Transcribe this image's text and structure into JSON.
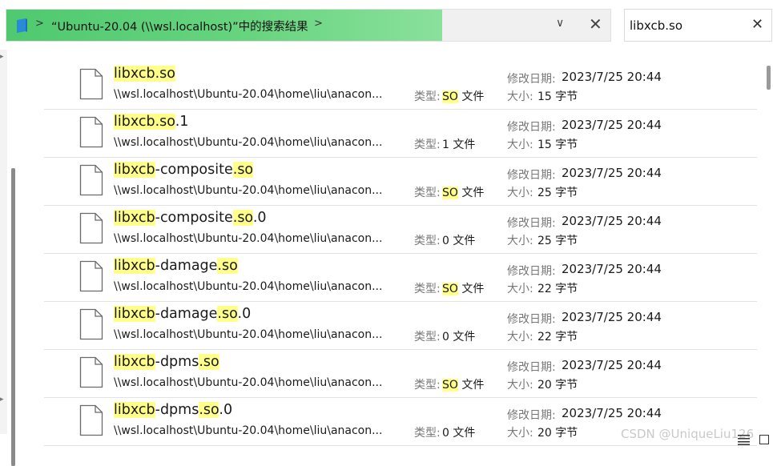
{
  "address_bar": {
    "breadcrumb": "“Ubuntu-20.04 (\\\\wsl.localhost)”中的搜索结果",
    "sep1": ">",
    "sep2": ">",
    "dropdown": "∨",
    "close": "✕"
  },
  "search": {
    "query": "libxcb.so",
    "clear": "✕"
  },
  "labels": {
    "type": "类型:",
    "date": "修改日期:",
    "size": "大小:"
  },
  "files": [
    {
      "name_parts": [
        {
          "t": "libxcb.so",
          "h": true
        }
      ],
      "path": "\\\\wsl.localhost\\Ubuntu-20.04\\home\\liu\\anacon...",
      "type_parts": [
        {
          "t": "SO",
          "h": true
        },
        {
          "t": " 文件",
          "h": false
        }
      ],
      "date": "2023/7/25 20:44",
      "size": "15 字节"
    },
    {
      "name_parts": [
        {
          "t": "libxcb.so",
          "h": true
        },
        {
          "t": ".1",
          "h": false
        }
      ],
      "path": "\\\\wsl.localhost\\Ubuntu-20.04\\home\\liu\\anacon...",
      "type_parts": [
        {
          "t": "1 文件",
          "h": false
        }
      ],
      "date": "2023/7/25 20:44",
      "size": "15 字节"
    },
    {
      "name_parts": [
        {
          "t": "libxcb",
          "h": true
        },
        {
          "t": "-composite",
          "h": false
        },
        {
          "t": ".so",
          "h": true
        }
      ],
      "path": "\\\\wsl.localhost\\Ubuntu-20.04\\home\\liu\\anacon...",
      "type_parts": [
        {
          "t": "SO",
          "h": true
        },
        {
          "t": " 文件",
          "h": false
        }
      ],
      "date": "2023/7/25 20:44",
      "size": "25 字节"
    },
    {
      "name_parts": [
        {
          "t": "libxcb",
          "h": true
        },
        {
          "t": "-composite",
          "h": false
        },
        {
          "t": ".so",
          "h": true
        },
        {
          "t": ".0",
          "h": false
        }
      ],
      "path": "\\\\wsl.localhost\\Ubuntu-20.04\\home\\liu\\anacon...",
      "type_parts": [
        {
          "t": "0 文件",
          "h": false
        }
      ],
      "date": "2023/7/25 20:44",
      "size": "25 字节"
    },
    {
      "name_parts": [
        {
          "t": "libxcb",
          "h": true
        },
        {
          "t": "-damage",
          "h": false
        },
        {
          "t": ".so",
          "h": true
        }
      ],
      "path": "\\\\wsl.localhost\\Ubuntu-20.04\\home\\liu\\anacon...",
      "type_parts": [
        {
          "t": "SO",
          "h": true
        },
        {
          "t": " 文件",
          "h": false
        }
      ],
      "date": "2023/7/25 20:44",
      "size": "22 字节"
    },
    {
      "name_parts": [
        {
          "t": "libxcb",
          "h": true
        },
        {
          "t": "-damage",
          "h": false
        },
        {
          "t": ".so",
          "h": true
        },
        {
          "t": ".0",
          "h": false
        }
      ],
      "path": "\\\\wsl.localhost\\Ubuntu-20.04\\home\\liu\\anacon...",
      "type_parts": [
        {
          "t": "0 文件",
          "h": false
        }
      ],
      "date": "2023/7/25 20:44",
      "size": "22 字节"
    },
    {
      "name_parts": [
        {
          "t": "libxcb",
          "h": true
        },
        {
          "t": "-dpms",
          "h": false
        },
        {
          "t": ".so",
          "h": true
        }
      ],
      "path": "\\\\wsl.localhost\\Ubuntu-20.04\\home\\liu\\anacon...",
      "type_parts": [
        {
          "t": "SO",
          "h": true
        },
        {
          "t": " 文件",
          "h": false
        }
      ],
      "date": "2023/7/25 20:44",
      "size": "20 字节"
    },
    {
      "name_parts": [
        {
          "t": "libxcb",
          "h": true
        },
        {
          "t": "-dpms",
          "h": false
        },
        {
          "t": ".so",
          "h": true
        },
        {
          "t": ".0",
          "h": false
        }
      ],
      "path": "\\\\wsl.localhost\\Ubuntu-20.04\\home\\liu\\anacon...",
      "type_parts": [
        {
          "t": "0 文件",
          "h": false
        }
      ],
      "date": "2023/7/25 20:44",
      "size": "20 字节"
    }
  ],
  "watermark": "CSDN @UniqueLiu126",
  "colors": {
    "address_accent": "#4fc970",
    "highlight": "#ffff8a"
  },
  "icons": {
    "drive": "drive-icon",
    "file": "file-icon",
    "view_details": "details-view-icon",
    "view_tiles": "tiles-view-icon"
  }
}
